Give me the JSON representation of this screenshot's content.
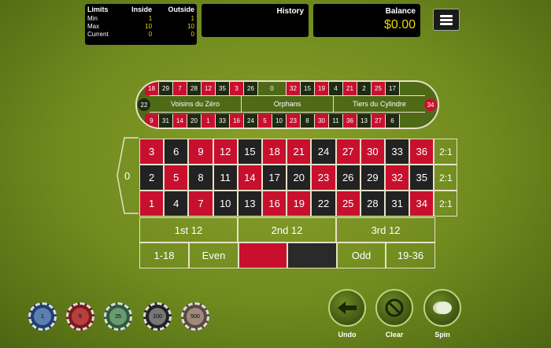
{
  "limits": {
    "title": "Limits",
    "inside_label": "Inside",
    "outside_label": "Outside",
    "rows": [
      {
        "label": "Min",
        "inside": "1",
        "outside": "1"
      },
      {
        "label": "Max",
        "inside": "10",
        "outside": "10"
      },
      {
        "label": "Current",
        "inside": "0",
        "outside": "0"
      }
    ]
  },
  "history": {
    "title": "History"
  },
  "balance": {
    "title": "Balance",
    "value": "$0.00"
  },
  "racetrack": {
    "top": [
      "18",
      "29",
      "7",
      "28",
      "12",
      "35",
      "3",
      "26",
      "0",
      "32",
      "15",
      "19",
      "4",
      "21",
      "2",
      "25",
      "17"
    ],
    "bottom": [
      "9",
      "31",
      "14",
      "20",
      "1",
      "33",
      "16",
      "24",
      "5",
      "10",
      "23",
      "8",
      "30",
      "11",
      "36",
      "13",
      "27",
      "6"
    ],
    "left": "22",
    "right": "34",
    "sections": [
      "Voisins du Zéro",
      "Orphans",
      "Tiers du Cylindre"
    ]
  },
  "board": {
    "zero": "0",
    "rows": [
      [
        "3",
        "6",
        "9",
        "12",
        "15",
        "18",
        "21",
        "24",
        "27",
        "30",
        "33",
        "36"
      ],
      [
        "2",
        "5",
        "8",
        "11",
        "14",
        "17",
        "20",
        "23",
        "26",
        "29",
        "32",
        "35"
      ],
      [
        "1",
        "4",
        "7",
        "10",
        "13",
        "16",
        "19",
        "22",
        "25",
        "28",
        "31",
        "34"
      ]
    ],
    "column_bet": "2:1",
    "dozens": [
      "1st 12",
      "2nd 12",
      "3rd 12"
    ],
    "outside": [
      "1-18",
      "Even",
      "",
      "",
      "Odd",
      "19-36"
    ]
  },
  "chips": [
    "1",
    "5",
    "25",
    "100",
    "500"
  ],
  "controls": {
    "undo": "Undo",
    "clear": "Clear",
    "spin": "Spin"
  },
  "colors": {
    "red": "#c8102e",
    "black": "#222222",
    "felt": "#6f8a1e",
    "accent": "#e6d800"
  },
  "icons": {
    "menu": "hamburger-menu-icon",
    "undo": "arrow-left-icon",
    "clear": "no-entry-icon",
    "spin": "spinning-chips-icon"
  }
}
